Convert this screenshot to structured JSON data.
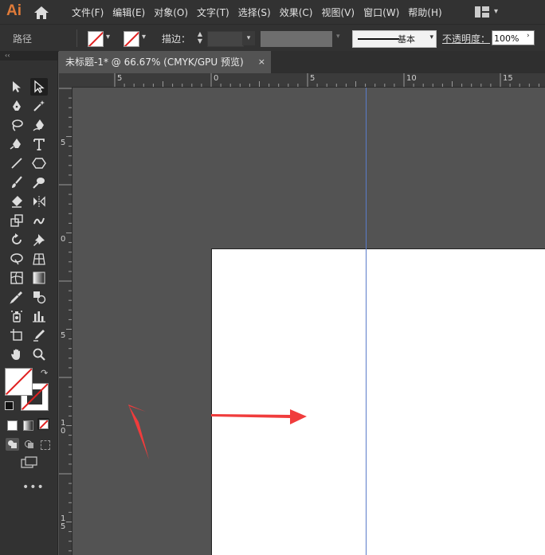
{
  "app": {
    "logo": "Ai"
  },
  "menu": [
    "文件(F)",
    "编辑(E)",
    "对象(O)",
    "文字(T)",
    "选择(S)",
    "效果(C)",
    "视图(V)",
    "窗口(W)",
    "帮助(H)"
  ],
  "control_bar": {
    "selection_label": "路径",
    "stroke_label": "描边：",
    "brush_label": "基本",
    "opacity_label": "不透明度：",
    "opacity_value": "100%"
  },
  "document_tab": {
    "title": "未标题-1* @ 66.67% (CMYK/GPU 预览)",
    "close": "×"
  },
  "ruler": {
    "horizontal_labels": [
      "5",
      "0",
      "5",
      "10",
      "15"
    ],
    "vertical_labels": [
      "5",
      "0",
      "5",
      "1\n0",
      "1\n5"
    ]
  },
  "toolbar": {
    "collapse_glyph": "‹‹",
    "tools": [
      "selection-tool",
      "direct-selection-tool",
      "pen-tool",
      "magic-wand-tool",
      "lasso-tool",
      "curvature-tool",
      "anchor-tool",
      "type-tool",
      "line-tool",
      "polygon-tool",
      "paintbrush-tool",
      "blob-brush-tool",
      "eraser-tool",
      "reflect-tool",
      "scale-tool",
      "warp-tool",
      "rotate-tool",
      "pin-tool",
      "free-transform-tool",
      "perspective-grid-tool",
      "mesh-tool",
      "gradient-tool",
      "eyedropper-tool",
      "shape-builder-tool",
      "symbol-sprayer-tool",
      "column-graph-tool",
      "artboard-tool",
      "slice-tool",
      "hand-tool",
      "zoom-tool"
    ]
  },
  "colors": {
    "accent": "#e02020",
    "arrow": "#f03c3c",
    "guide": "#5a7bc8",
    "canvas_bg": "#535353",
    "chrome_bg": "#323232"
  }
}
